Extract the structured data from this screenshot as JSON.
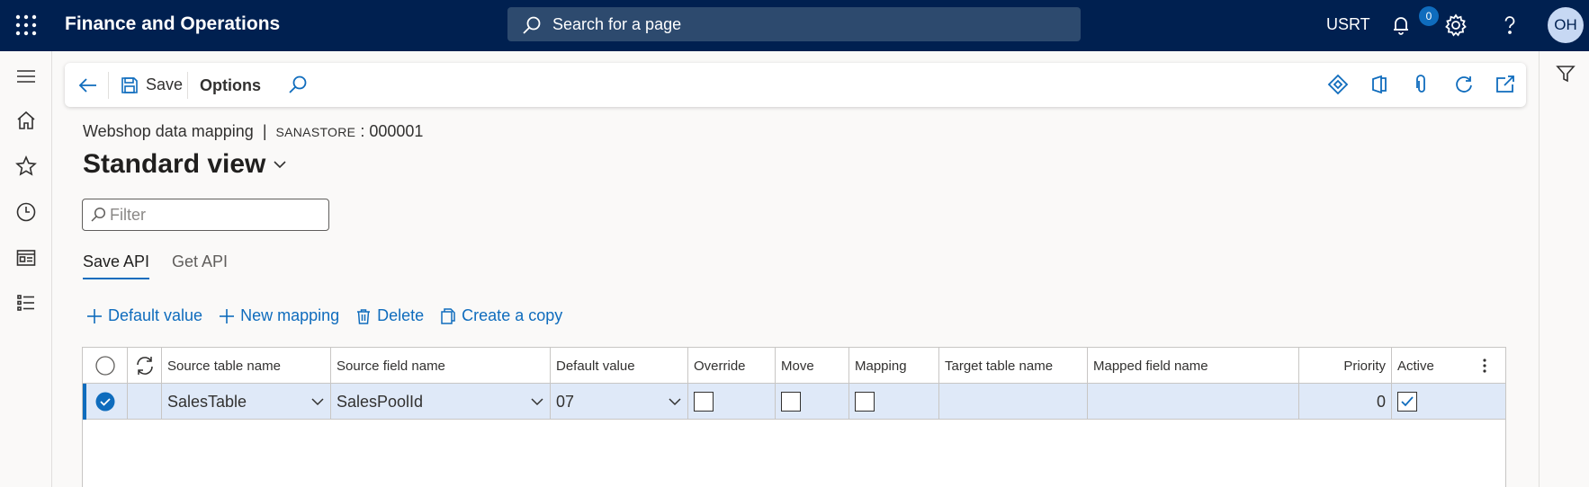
{
  "app": {
    "title": "Finance and Operations",
    "search_placeholder": "Search for a page",
    "company": "USRT",
    "user_initials": "OH"
  },
  "actionpane": {
    "save_label": "Save",
    "options_label": "Options",
    "attachments_count": "0"
  },
  "page": {
    "breadcrumb_form": "Webshop data mapping",
    "breadcrumb_separator": "|",
    "breadcrumb_record_prefix": "SANASTORE",
    "breadcrumb_record_suffix": ": 000001",
    "view_name": "Standard view",
    "filter_placeholder": "Filter"
  },
  "tabs": [
    {
      "label": "Save API",
      "active": true
    },
    {
      "label": "Get API",
      "active": false
    }
  ],
  "grid_toolbar": {
    "default_value": "Default value",
    "new_mapping": "New mapping",
    "delete": "Delete",
    "create_copy": "Create a copy"
  },
  "grid": {
    "columns": {
      "source_table": "Source table name",
      "source_field": "Source field name",
      "default_value": "Default value",
      "override": "Override",
      "move": "Move",
      "mapping": "Mapping",
      "target_table": "Target table name",
      "mapped_field": "Mapped field name",
      "priority": "Priority",
      "active": "Active"
    },
    "rows": [
      {
        "selected": true,
        "source_table": "SalesTable",
        "source_field": "SalesPoolId",
        "default_value": "07",
        "override": false,
        "move": false,
        "mapping": false,
        "target_table": "",
        "mapped_field": "",
        "priority": "0",
        "active": true
      }
    ]
  },
  "colors": {
    "topbar": "#002050",
    "accent": "#0f6cbd",
    "selected_row": "#dfe9f8"
  }
}
